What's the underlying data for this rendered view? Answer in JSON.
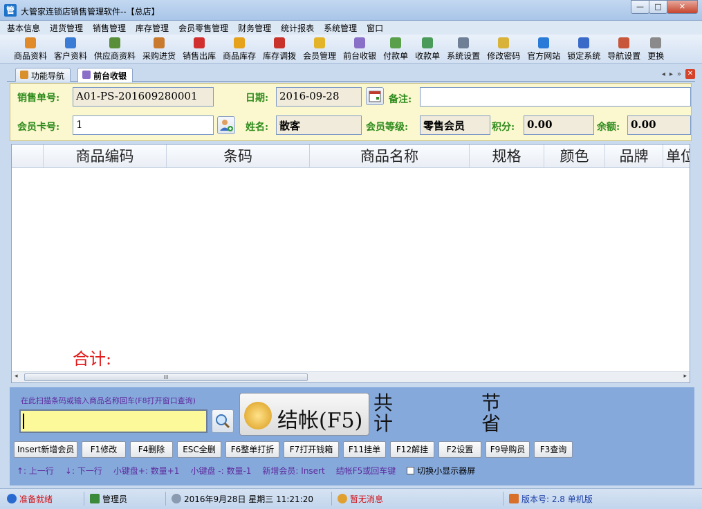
{
  "window": {
    "app_icon": "管",
    "title": "大管家连锁店销售管理软件--【总店】",
    "min_label": "—",
    "restore_label": "□",
    "close_label": "✕"
  },
  "menu": [
    "基本信息",
    "进货管理",
    "销售管理",
    "库存管理",
    "会员零售管理",
    "财务管理",
    "统计报表",
    "系统管理",
    "窗口"
  ],
  "toolbar": [
    {
      "label": "商品资料",
      "icon": "product-icon",
      "color": "#e08a2a"
    },
    {
      "label": "客户资料",
      "icon": "customer-icon",
      "color": "#3a7bd5"
    },
    {
      "label": "供应商资料",
      "icon": "supplier-icon",
      "color": "#5a8f3a"
    },
    {
      "label": "采购进货",
      "icon": "truck-icon",
      "color": "#c97a2e"
    },
    {
      "label": "销售出库",
      "icon": "basket-icon",
      "color": "#d12f2f"
    },
    {
      "label": "商品库存",
      "icon": "warehouse-icon",
      "color": "#e6a21a"
    },
    {
      "label": "库存调拨",
      "icon": "transfer-icon",
      "color": "#c8322a"
    },
    {
      "label": "会员管理",
      "icon": "member-icon",
      "color": "#e3b42a"
    },
    {
      "label": "前台收银",
      "icon": "cashier-icon",
      "color": "#8a6fc9"
    },
    {
      "label": "付款单",
      "icon": "payment-icon",
      "color": "#5aa04a"
    },
    {
      "label": "收款单",
      "icon": "receipt-icon",
      "color": "#4a9a5a"
    },
    {
      "label": "系统设置",
      "icon": "settings-icon",
      "color": "#6f7f95"
    },
    {
      "label": "修改密码",
      "icon": "password-icon",
      "color": "#d9b23a"
    },
    {
      "label": "官方网站",
      "icon": "ie-icon",
      "color": "#2a7ad8"
    },
    {
      "label": "锁定系统",
      "icon": "lock-icon",
      "color": "#3a6ac8"
    },
    {
      "label": "导航设置",
      "icon": "nav-settings-icon",
      "color": "#c7563a"
    },
    {
      "label": "更换",
      "icon": "switch-icon",
      "color": "#8a8a8a"
    }
  ],
  "tabs": [
    {
      "label": "功能导航",
      "active": false
    },
    {
      "label": "前台收银",
      "active": true
    }
  ],
  "tabnav": {
    "left": "◂",
    "right": "▸",
    "more": "»",
    "close": "✕"
  },
  "form": {
    "order_no_label": "销售单号:",
    "order_no_value": "A01-PS-201609280001",
    "date_label": "日期:",
    "date_value": "2016-09-28",
    "note_label": "备注:",
    "note_value": "",
    "card_label": "会员卡号:",
    "card_value": "1",
    "name_label": "姓名:",
    "name_value": "散客",
    "level_label": "会员等级:",
    "level_value": "零售会员",
    "points_label": "积分:",
    "points_value": "0.00",
    "balance_label": "余额:",
    "balance_value": "0.00"
  },
  "grid": {
    "columns": [
      "",
      "商品编码",
      "条码",
      "商品名称",
      "规格",
      "颜色",
      "品牌",
      "单位"
    ],
    "rows": [],
    "total_label": "合计:",
    "scroll_thumb": "III",
    "scroll_left": "◂",
    "scroll_right": "▸"
  },
  "checkout": {
    "scan_hint": "在此扫描条码或输入商品名称回车(F8打开窗口查询)",
    "scan_value": "",
    "checkout_label": "结帐(F5)",
    "total_items_label": "共计",
    "saved_label": "节省"
  },
  "fkeys": [
    "Insert新增会员",
    "F1修改",
    "F4删除",
    "ESC全删",
    "F6整单打折",
    "F7打开钱箱",
    "F11挂单",
    "F12解挂",
    "F2设置",
    "F9导购员",
    "F3查询"
  ],
  "hints": [
    "↑: 上一行",
    "↓: 下一行",
    "小键盘+: 数量+1",
    "小键盘 -: 数量-1",
    "新增会员: Insert",
    "结帐F5或回车键"
  ],
  "small_screen_label": "切换小显示器屏",
  "status": {
    "ready": "准备就绪",
    "user": "管理员",
    "datetime": "2016年9月28日    星期三       11:21:20",
    "message": "暂无消息",
    "version": "版本号: 2.8 单机版"
  },
  "colors": {
    "accent_green": "#2b8a1a",
    "total_red": "#e31a1a",
    "hint_purple": "#5d2a9c",
    "status_red": "#d0131a",
    "status_blue": "#1a3ea8"
  }
}
